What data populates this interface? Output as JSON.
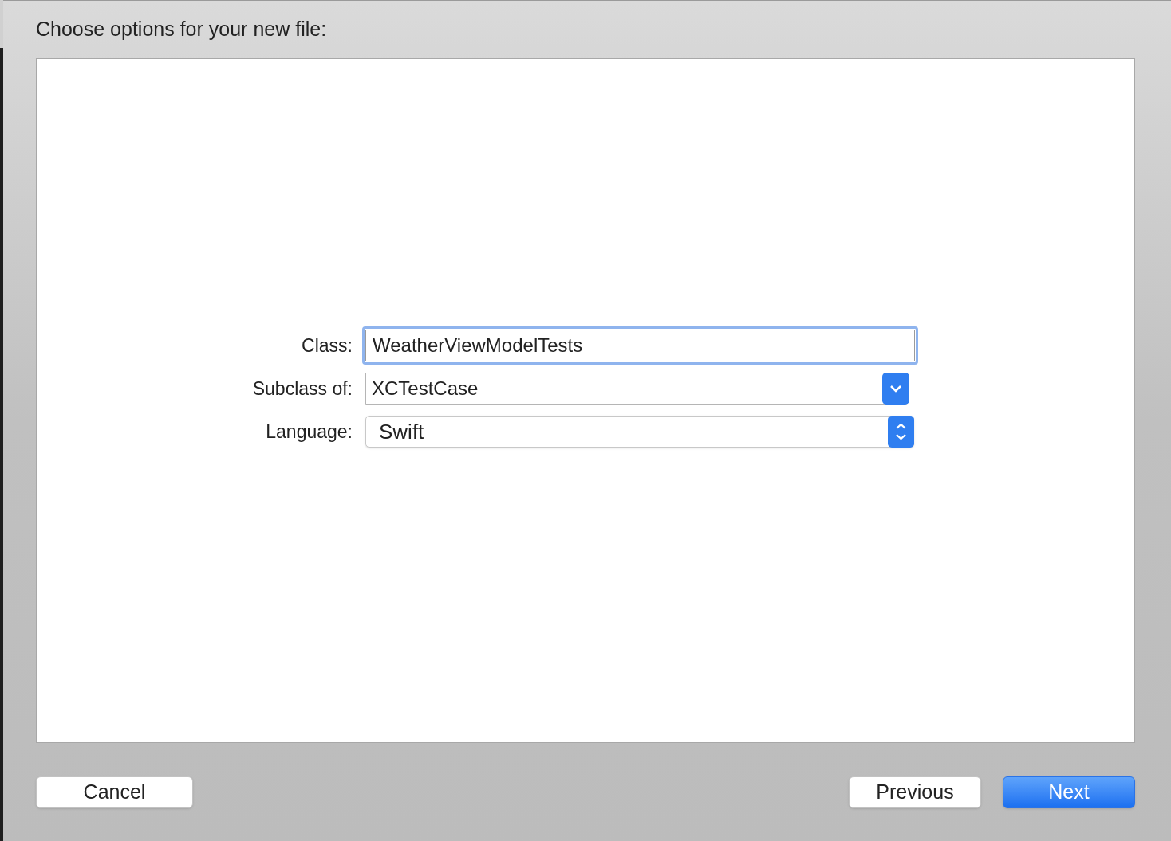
{
  "dialog": {
    "title": "Choose options for your new file:"
  },
  "fields": [
    {
      "kind": "text",
      "label": "Class:",
      "value": "WeatherViewModelTests",
      "focused": true
    },
    {
      "kind": "combo",
      "label": "Subclass of:",
      "value": "XCTestCase",
      "focused": false
    },
    {
      "kind": "popup",
      "label": "Language:",
      "value": "Swift",
      "focused": false
    }
  ],
  "left_buttons": [
    {
      "label": "Cancel",
      "default": false
    }
  ],
  "right_buttons": [
    {
      "label": "Previous",
      "default": false
    },
    {
      "label": "Next",
      "default": true
    }
  ]
}
